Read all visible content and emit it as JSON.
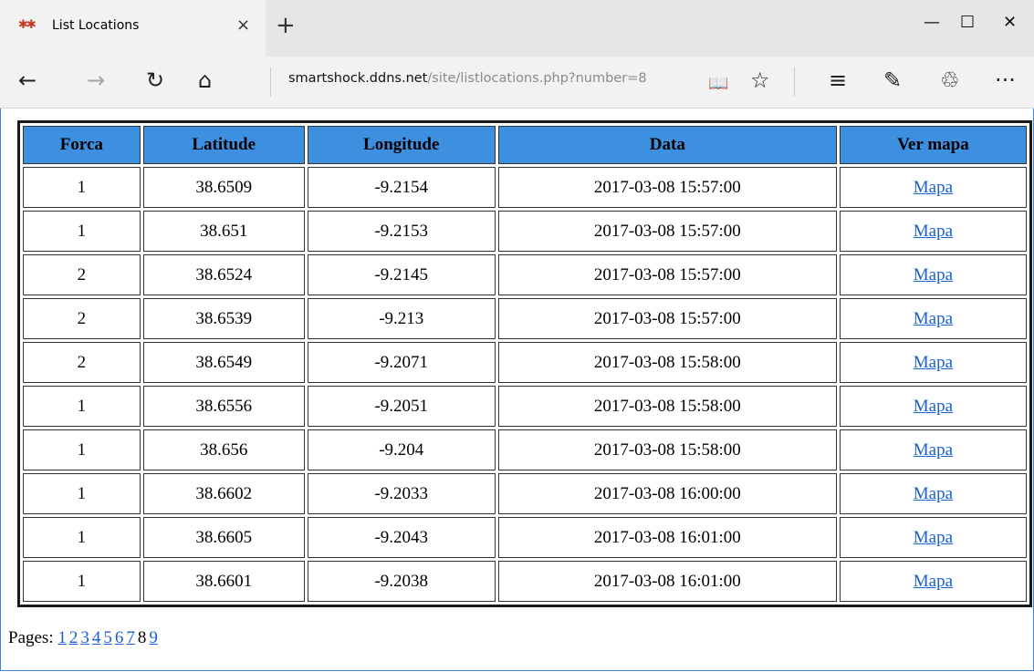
{
  "tab": {
    "title": "List Locations",
    "favicon_glyph": "✱✱",
    "close_glyph": "×",
    "new_tab_glyph": "+"
  },
  "window": {
    "minimize_glyph": "—",
    "maximize_glyph": "☐",
    "close_glyph": "✕"
  },
  "nav": {
    "back_glyph": "←",
    "forward_glyph": "→",
    "refresh_glyph": "↻",
    "home_glyph": "⌂",
    "reading_view_glyph": "📖",
    "favorite_glyph": "☆",
    "hub_glyph": "≡",
    "notes_glyph": "✎",
    "share_glyph": "♲",
    "more_glyph": "···"
  },
  "address": {
    "host": "smartshock.ddns.net",
    "path": "/site/listlocations.php?number=8"
  },
  "table": {
    "headers": [
      "Forca",
      "Latitude",
      "Longitude",
      "Data",
      "Ver mapa"
    ],
    "link_label": "Mapa",
    "rows": [
      [
        "1",
        "38.6509",
        "-9.2154",
        "2017-03-08 15:57:00"
      ],
      [
        "1",
        "38.651",
        "-9.2153",
        "2017-03-08 15:57:00"
      ],
      [
        "2",
        "38.6524",
        "-9.2145",
        "2017-03-08 15:57:00"
      ],
      [
        "2",
        "38.6539",
        "-9.213",
        "2017-03-08 15:57:00"
      ],
      [
        "2",
        "38.6549",
        "-9.2071",
        "2017-03-08 15:58:00"
      ],
      [
        "1",
        "38.6556",
        "-9.2051",
        "2017-03-08 15:58:00"
      ],
      [
        "1",
        "38.656",
        "-9.204",
        "2017-03-08 15:58:00"
      ],
      [
        "1",
        "38.6602",
        "-9.2033",
        "2017-03-08 16:00:00"
      ],
      [
        "1",
        "38.6605",
        "-9.2043",
        "2017-03-08 16:01:00"
      ],
      [
        "1",
        "38.6601",
        "-9.2038",
        "2017-03-08 16:01:00"
      ]
    ]
  },
  "pagination": {
    "label": "Pages:",
    "pages": [
      "1",
      "2",
      "3",
      "4",
      "5",
      "6",
      "7",
      "8",
      "9"
    ],
    "current": "8"
  },
  "colors": {
    "header_bg": "#3d8fe0",
    "link": "#1a5fd1"
  }
}
